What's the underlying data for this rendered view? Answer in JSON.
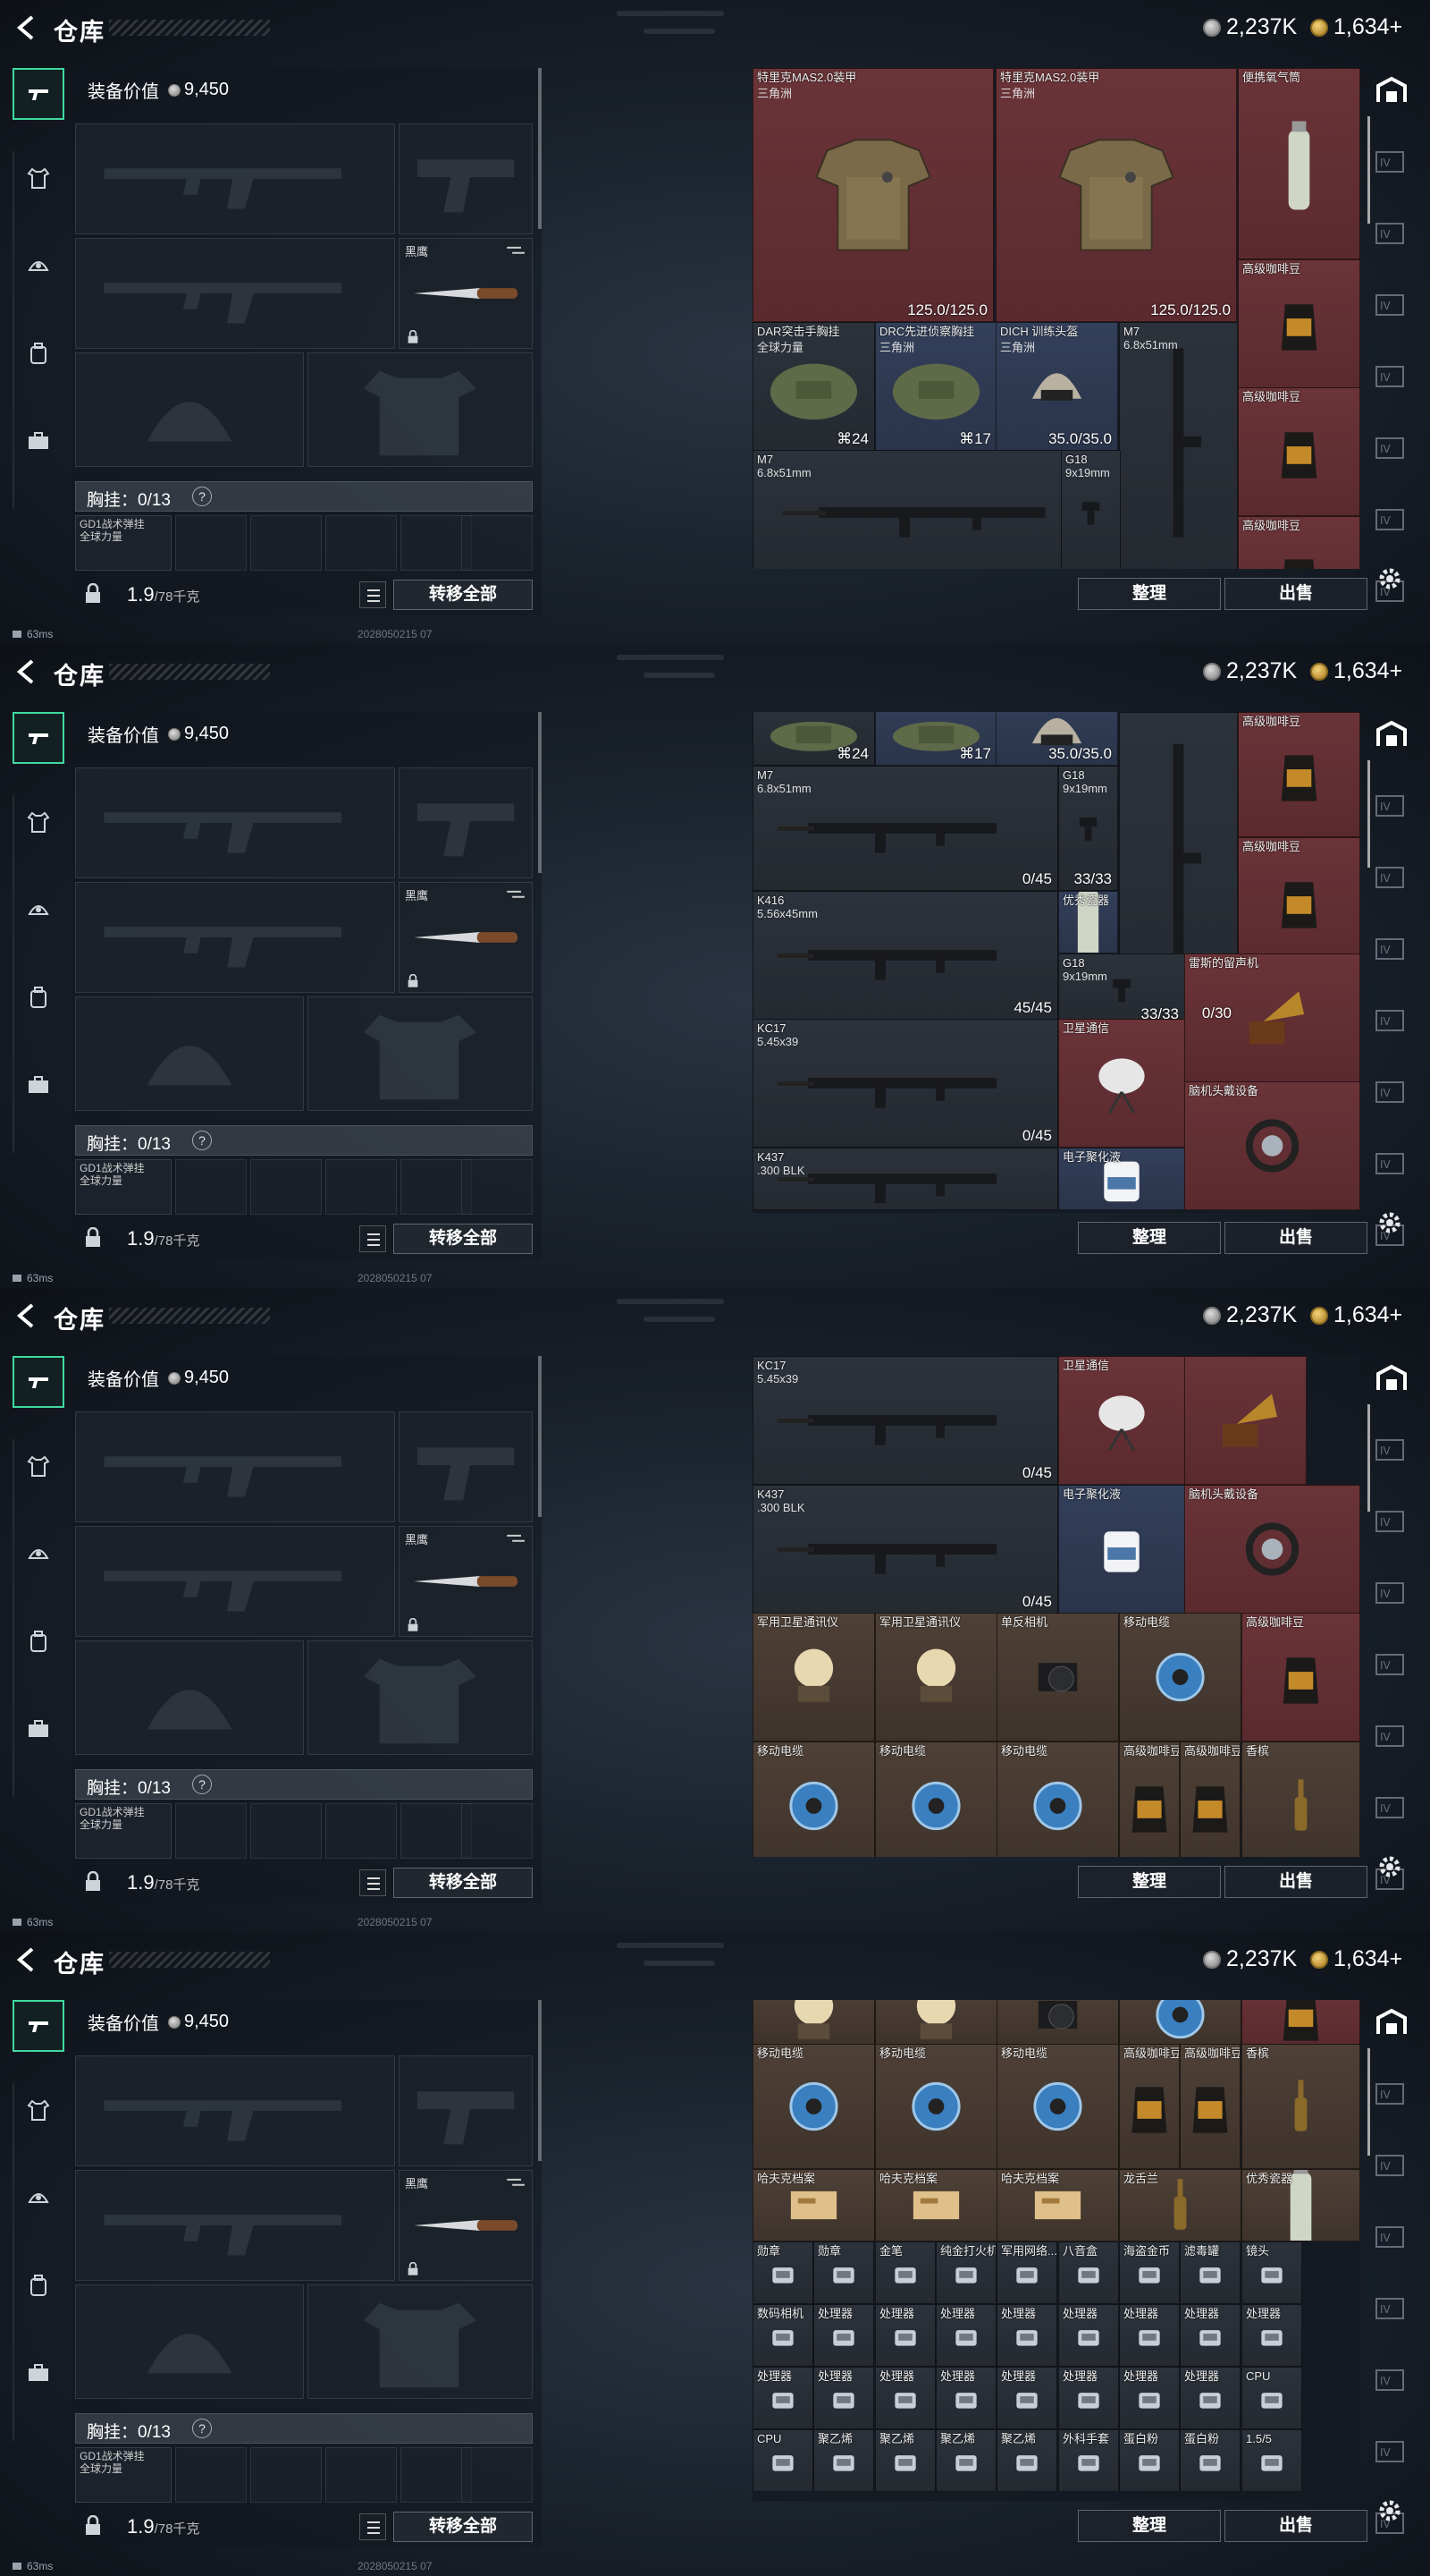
{
  "header": {
    "title": "仓库",
    "currency_silver": "2,237K",
    "currency_gold": "1,634+"
  },
  "equipment": {
    "value_label": "装备价值",
    "value": "9,450",
    "knife_label": "黑鹰",
    "chest_label": "胸挂：0/13",
    "chest_help": "?",
    "chest_item": "GD1战术弹挂\n全球力量",
    "weight": "1.9",
    "weight_max": "/78千克",
    "transfer_all": "转移全部"
  },
  "status": {
    "ping": "63ms",
    "build": "2028050215 07"
  },
  "buttons": {
    "sort": "整理",
    "sell": "出售"
  },
  "colors": {
    "accent": "#3fd9a0",
    "red_rarity": "#6a3438",
    "blue_rarity": "#33405a",
    "gold_rarity": "#5b4a30"
  },
  "icons": [
    "back-arrow-icon",
    "rifle-icon",
    "armor-icon",
    "helmet-icon",
    "backpack-icon",
    "case-icon",
    "coin-icon",
    "lock-icon",
    "list-icon",
    "gear-icon",
    "warehouse-icon",
    "page-icon"
  ],
  "panels": [
    {
      "cells": [
        {
          "name": "特里克MAS2.0装甲",
          "sub": "三角洲",
          "val": "125.0/125.0",
          "c": "red",
          "art": "armor"
        },
        {
          "name": "特里克MAS2.0装甲",
          "sub": "三角洲",
          "val": "125.0/125.0",
          "c": "red",
          "art": "armor"
        },
        {
          "name": "便携氧气筒",
          "sub": "",
          "val": "",
          "c": "red",
          "art": "can"
        },
        {
          "name": "高级咖啡豆",
          "sub": "",
          "val": "",
          "c": "red",
          "art": "bag"
        },
        {
          "name": "DAR突击手胸挂",
          "sub": "全球力量",
          "val": "⌘24",
          "c": "dark",
          "art": "rig"
        },
        {
          "name": "DRC先进侦察胸挂",
          "sub": "三角洲",
          "val": "⌘17",
          "c": "blue",
          "art": "rig"
        },
        {
          "name": "DICH 训练头盔",
          "sub": "三角洲",
          "val": "35.0/35.0",
          "c": "blue",
          "art": "helmet"
        },
        {
          "name": "M7",
          "sub": "6.8x51mm",
          "val": "",
          "c": "dark",
          "art": "rifleV"
        },
        {
          "name": "高级咖啡豆",
          "sub": "",
          "val": "",
          "c": "red",
          "art": "bag"
        },
        {
          "name": "M7",
          "sub": "6.8x51mm",
          "val": "",
          "c": "dark",
          "art": "rifle"
        },
        {
          "name": "G18",
          "sub": "9x19mm",
          "val": "",
          "c": "dark",
          "art": "pistol"
        },
        {
          "name": "高级咖啡豆",
          "sub": "",
          "val": "",
          "c": "red",
          "art": "bag"
        }
      ]
    },
    {
      "cells": [
        {
          "name": "",
          "sub": "",
          "val": "⌘24",
          "c": "dark",
          "art": "rig"
        },
        {
          "name": "",
          "sub": "",
          "val": "⌘17",
          "c": "blue",
          "art": "rig"
        },
        {
          "name": "",
          "sub": "",
          "val": "35.0/35.0",
          "c": "blue",
          "art": "helmet"
        },
        {
          "name": "高级咖啡豆",
          "sub": "",
          "val": "",
          "c": "red",
          "art": "bag"
        },
        {
          "name": "M7",
          "sub": "6.8x51mm",
          "val": "0/45",
          "c": "dark",
          "art": "rifle"
        },
        {
          "name": "G18",
          "sub": "9x19mm",
          "val": "33/33",
          "c": "dark",
          "art": "pistol"
        },
        {
          "name": "",
          "sub": "",
          "val": "0/30",
          "c": "dark",
          "art": "rifleV"
        },
        {
          "name": "高级咖啡豆",
          "sub": "",
          "val": "",
          "c": "red",
          "art": "bag"
        },
        {
          "name": "K416",
          "sub": "5.56x45mm",
          "val": "45/45",
          "c": "dark",
          "art": "rifle"
        },
        {
          "name": "优秀瓷器",
          "sub": "",
          "val": "",
          "c": "blue",
          "art": "can"
        },
        {
          "name": "G18",
          "sub": "9x19mm",
          "val": "33/33",
          "c": "dark",
          "art": "pistol"
        },
        {
          "name": "雷斯的留声机",
          "sub": "",
          "val": "",
          "c": "red",
          "art": "phono"
        },
        {
          "name": "KC17",
          "sub": "5.45x39",
          "val": "0/45",
          "c": "dark",
          "art": "rifle"
        },
        {
          "name": "卫星通信",
          "sub": "",
          "val": "",
          "c": "red",
          "art": "dish"
        },
        {
          "name": "K437",
          "sub": ".300 BLK",
          "val": "",
          "c": "dark",
          "art": "rifle"
        },
        {
          "name": "电子聚化液",
          "sub": "",
          "val": "",
          "c": "blue",
          "art": "jug"
        },
        {
          "name": "脑机头戴设备",
          "sub": "",
          "val": "",
          "c": "red",
          "art": "head"
        }
      ]
    },
    {
      "cells": [
        {
          "name": "KC17",
          "sub": "5.45x39",
          "val": "0/45",
          "c": "dark",
          "art": "rifle"
        },
        {
          "name": "卫星通信",
          "sub": "",
          "val": "",
          "c": "red",
          "art": "dish"
        },
        {
          "name": "",
          "sub": "",
          "val": "",
          "c": "red",
          "art": "phono"
        },
        {
          "name": "K437",
          "sub": ".300 BLK",
          "val": "0/45",
          "c": "dark",
          "art": "rifle"
        },
        {
          "name": "电子聚化液",
          "sub": "",
          "val": "",
          "c": "blue",
          "art": "jug"
        },
        {
          "name": "脑机头戴设备",
          "sub": "",
          "val": "",
          "c": "red",
          "art": "head"
        },
        {
          "name": "军用卫星通讯仪",
          "sub": "",
          "val": "",
          "c": "brown",
          "art": "sat"
        },
        {
          "name": "军用卫星通讯仪",
          "sub": "",
          "val": "",
          "c": "brown",
          "art": "sat"
        },
        {
          "name": "单反相机",
          "sub": "",
          "val": "",
          "c": "brown",
          "art": "camera"
        },
        {
          "name": "移动电缆",
          "sub": "",
          "val": "",
          "c": "brown",
          "art": "reel"
        },
        {
          "name": "高级咖啡豆",
          "sub": "",
          "val": "",
          "c": "red",
          "art": "bag"
        },
        {
          "name": "移动电缆",
          "sub": "",
          "val": "",
          "c": "brown",
          "art": "reel"
        },
        {
          "name": "移动电缆",
          "sub": "",
          "val": "",
          "c": "brown",
          "art": "reel"
        },
        {
          "name": "移动电缆",
          "sub": "",
          "val": "",
          "c": "brown",
          "art": "reel"
        },
        {
          "name": "高级咖啡豆",
          "sub": "",
          "val": "",
          "c": "brown",
          "art": "bag"
        },
        {
          "name": "高级咖啡豆",
          "sub": "",
          "val": "",
          "c": "brown",
          "art": "bag"
        },
        {
          "name": "香槟",
          "sub": "",
          "val": "",
          "c": "brown",
          "art": "bottle"
        }
      ]
    },
    {
      "cells": [
        {
          "name": "",
          "sub": "",
          "val": "",
          "c": "brown",
          "art": "sat"
        },
        {
          "name": "",
          "sub": "",
          "val": "",
          "c": "brown",
          "art": "sat"
        },
        {
          "name": "",
          "sub": "",
          "val": "",
          "c": "brown",
          "art": "camera"
        },
        {
          "name": "",
          "sub": "",
          "val": "",
          "c": "brown",
          "art": "reel"
        },
        {
          "name": "",
          "sub": "",
          "val": "",
          "c": "red",
          "art": "bag"
        },
        {
          "name": "移动电缆",
          "sub": "",
          "val": "",
          "c": "brown",
          "art": "reel"
        },
        {
          "name": "移动电缆",
          "sub": "",
          "val": "",
          "c": "brown",
          "art": "reel"
        },
        {
          "name": "移动电缆",
          "sub": "",
          "val": "",
          "c": "brown",
          "art": "reel"
        },
        {
          "name": "高级咖啡豆",
          "sub": "",
          "val": "",
          "c": "brown",
          "art": "bag"
        },
        {
          "name": "高级咖啡豆",
          "sub": "",
          "val": "",
          "c": "brown",
          "art": "bag"
        },
        {
          "name": "香槟",
          "sub": "",
          "val": "",
          "c": "brown",
          "art": "bottle"
        },
        {
          "name": "哈夫克档案",
          "sub": "",
          "val": "",
          "c": "brown",
          "art": "doc"
        },
        {
          "name": "哈夫克档案",
          "sub": "",
          "val": "",
          "c": "brown",
          "art": "doc"
        },
        {
          "name": "哈夫克档案",
          "sub": "",
          "val": "",
          "c": "brown",
          "art": "doc"
        },
        {
          "name": "龙舌兰",
          "sub": "",
          "val": "",
          "c": "brown",
          "art": "bottle"
        },
        {
          "name": "优秀瓷器",
          "sub": "",
          "val": "",
          "c": "brown",
          "art": "can"
        },
        {
          "name": "勋章",
          "sub": "",
          "val": "",
          "c": "dark",
          "art": "small"
        },
        {
          "name": "勋章",
          "sub": "",
          "val": "",
          "c": "dark",
          "art": "small"
        },
        {
          "name": "金笔",
          "sub": "",
          "val": "",
          "c": "dark",
          "art": "small"
        },
        {
          "name": "纯金打火机",
          "sub": "",
          "val": "",
          "c": "dark",
          "art": "small"
        },
        {
          "name": "军用网络...",
          "sub": "",
          "val": "",
          "c": "dark",
          "art": "small"
        },
        {
          "name": "八音盒",
          "sub": "",
          "val": "",
          "c": "dark",
          "art": "small"
        },
        {
          "name": "海盗金币",
          "sub": "",
          "val": "",
          "c": "dark",
          "art": "small"
        },
        {
          "name": "滤毒罐",
          "sub": "",
          "val": "",
          "c": "dark",
          "art": "small"
        },
        {
          "name": "镜头",
          "sub": "",
          "val": "",
          "c": "dark",
          "art": "small"
        },
        {
          "name": "数码相机",
          "sub": "",
          "val": "",
          "c": "dark",
          "art": "small"
        },
        {
          "name": "处理器",
          "sub": "",
          "val": "",
          "c": "dark",
          "art": "small"
        },
        {
          "name": "处理器",
          "sub": "",
          "val": "",
          "c": "dark",
          "art": "small"
        },
        {
          "name": "处理器",
          "sub": "",
          "val": "",
          "c": "dark",
          "art": "small"
        },
        {
          "name": "处理器",
          "sub": "",
          "val": "",
          "c": "dark",
          "art": "small"
        },
        {
          "name": "处理器",
          "sub": "",
          "val": "",
          "c": "dark",
          "art": "small"
        },
        {
          "name": "处理器",
          "sub": "",
          "val": "",
          "c": "dark",
          "art": "small"
        },
        {
          "name": "处理器",
          "sub": "",
          "val": "",
          "c": "dark",
          "art": "small"
        },
        {
          "name": "处理器",
          "sub": "",
          "val": "",
          "c": "dark",
          "art": "small"
        },
        {
          "name": "处理器",
          "sub": "",
          "val": "",
          "c": "dark",
          "art": "small"
        },
        {
          "name": "处理器",
          "sub": "",
          "val": "",
          "c": "dark",
          "art": "small"
        },
        {
          "name": "处理器",
          "sub": "",
          "val": "",
          "c": "dark",
          "art": "small"
        },
        {
          "name": "处理器",
          "sub": "",
          "val": "",
          "c": "dark",
          "art": "small"
        },
        {
          "name": "处理器",
          "sub": "",
          "val": "",
          "c": "dark",
          "art": "small"
        },
        {
          "name": "处理器",
          "sub": "",
          "val": "",
          "c": "dark",
          "art": "small"
        },
        {
          "name": "处理器",
          "sub": "",
          "val": "",
          "c": "dark",
          "art": "small"
        },
        {
          "name": "处理器",
          "sub": "",
          "val": "",
          "c": "dark",
          "art": "small"
        },
        {
          "name": "CPU",
          "sub": "",
          "val": "",
          "c": "dark",
          "art": "small"
        },
        {
          "name": "CPU",
          "sub": "",
          "val": "",
          "c": "dark",
          "art": "small"
        },
        {
          "name": "聚乙烯",
          "sub": "",
          "val": "",
          "c": "dark",
          "art": "small"
        },
        {
          "name": "聚乙烯",
          "sub": "",
          "val": "",
          "c": "dark",
          "art": "small"
        },
        {
          "name": "聚乙烯",
          "sub": "",
          "val": "",
          "c": "dark",
          "art": "small"
        },
        {
          "name": "聚乙烯",
          "sub": "",
          "val": "",
          "c": "dark",
          "art": "small"
        },
        {
          "name": "外科手套",
          "sub": "",
          "val": "",
          "c": "dark",
          "art": "small"
        },
        {
          "name": "蛋白粉",
          "sub": "",
          "val": "",
          "c": "dark",
          "art": "small"
        },
        {
          "name": "蛋白粉",
          "sub": "",
          "val": "",
          "c": "dark",
          "art": "small"
        },
        {
          "name": "1.5/5",
          "sub": "",
          "val": "",
          "c": "dark",
          "art": "small"
        }
      ]
    }
  ]
}
